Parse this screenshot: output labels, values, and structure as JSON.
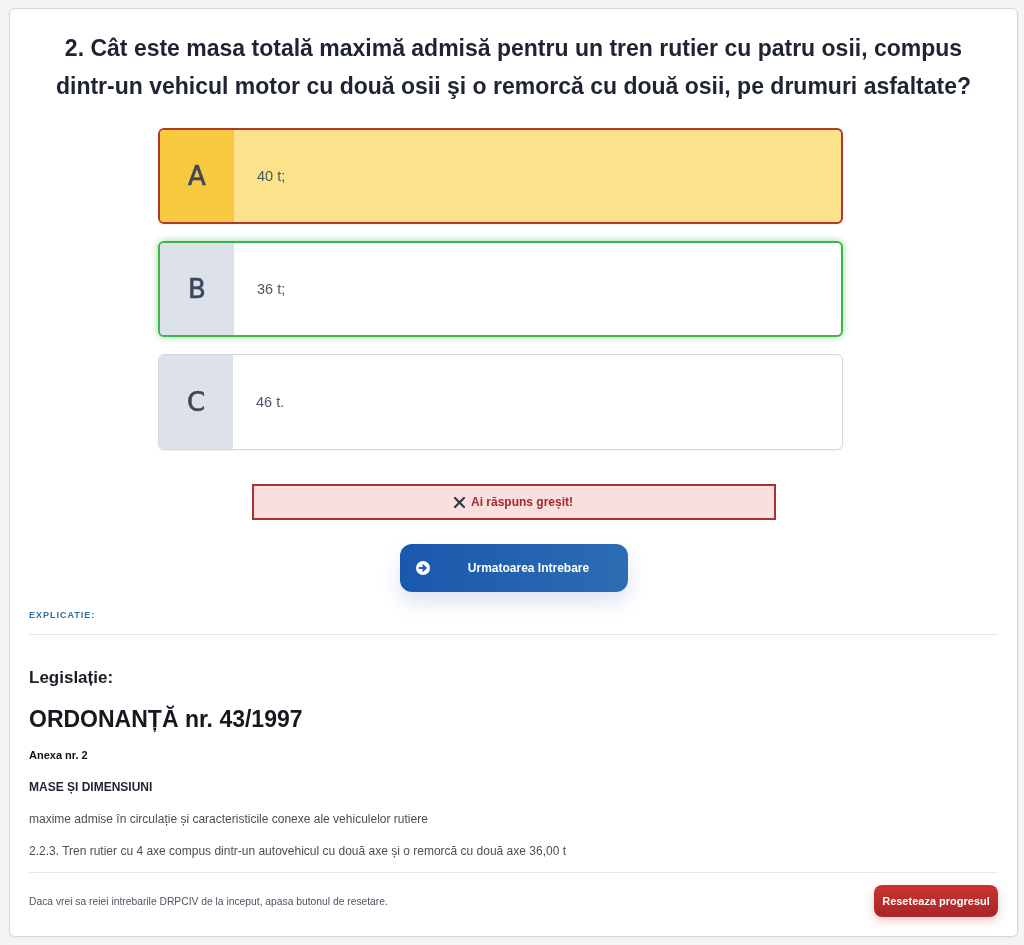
{
  "question": {
    "text": "2. Cât este masa totală maximă admisă pentru un tren rutier cu patru osii, compus dintr-un vehicul motor cu două osii şi o remorcă cu două osii, pe drumuri asfaltate?"
  },
  "options": [
    {
      "letter": "A",
      "text": "40 t;",
      "selected": true,
      "correct": false
    },
    {
      "letter": "B",
      "text": "36 t;",
      "selected": false,
      "correct": true
    },
    {
      "letter": "C",
      "text": "46 t.",
      "selected": false,
      "correct": false
    }
  ],
  "result": {
    "correct": false,
    "text": "Ai răspuns greșit!"
  },
  "next_button": {
    "label": "Urmatoarea Intrebare"
  },
  "explanation": {
    "label": "EXPLICATIE:",
    "heading": "Legislație:",
    "title": "ORDONANȚĂ nr. 43/1997",
    "paragraphs": [
      {
        "kind": "annex",
        "text": "Anexa nr. 2"
      },
      {
        "kind": "heading",
        "text": "MASE ȘI DIMENSIUNI"
      },
      {
        "kind": "text",
        "text": "maxime admise în circulație și caracteristicile conexe ale vehiculelor rutiere"
      },
      {
        "kind": "text",
        "text": "2.2.3. Tren rutier cu 4 axe compus dintr-un autovehicul cu două axe și o remorcă cu două axe 36,00 t"
      }
    ]
  },
  "footer": {
    "note": "Daca vrei sa reiei intrebarile DRPCIV de la inceput, apasa butonul de resetare.",
    "reset_button": "Reseteaza progresul"
  }
}
